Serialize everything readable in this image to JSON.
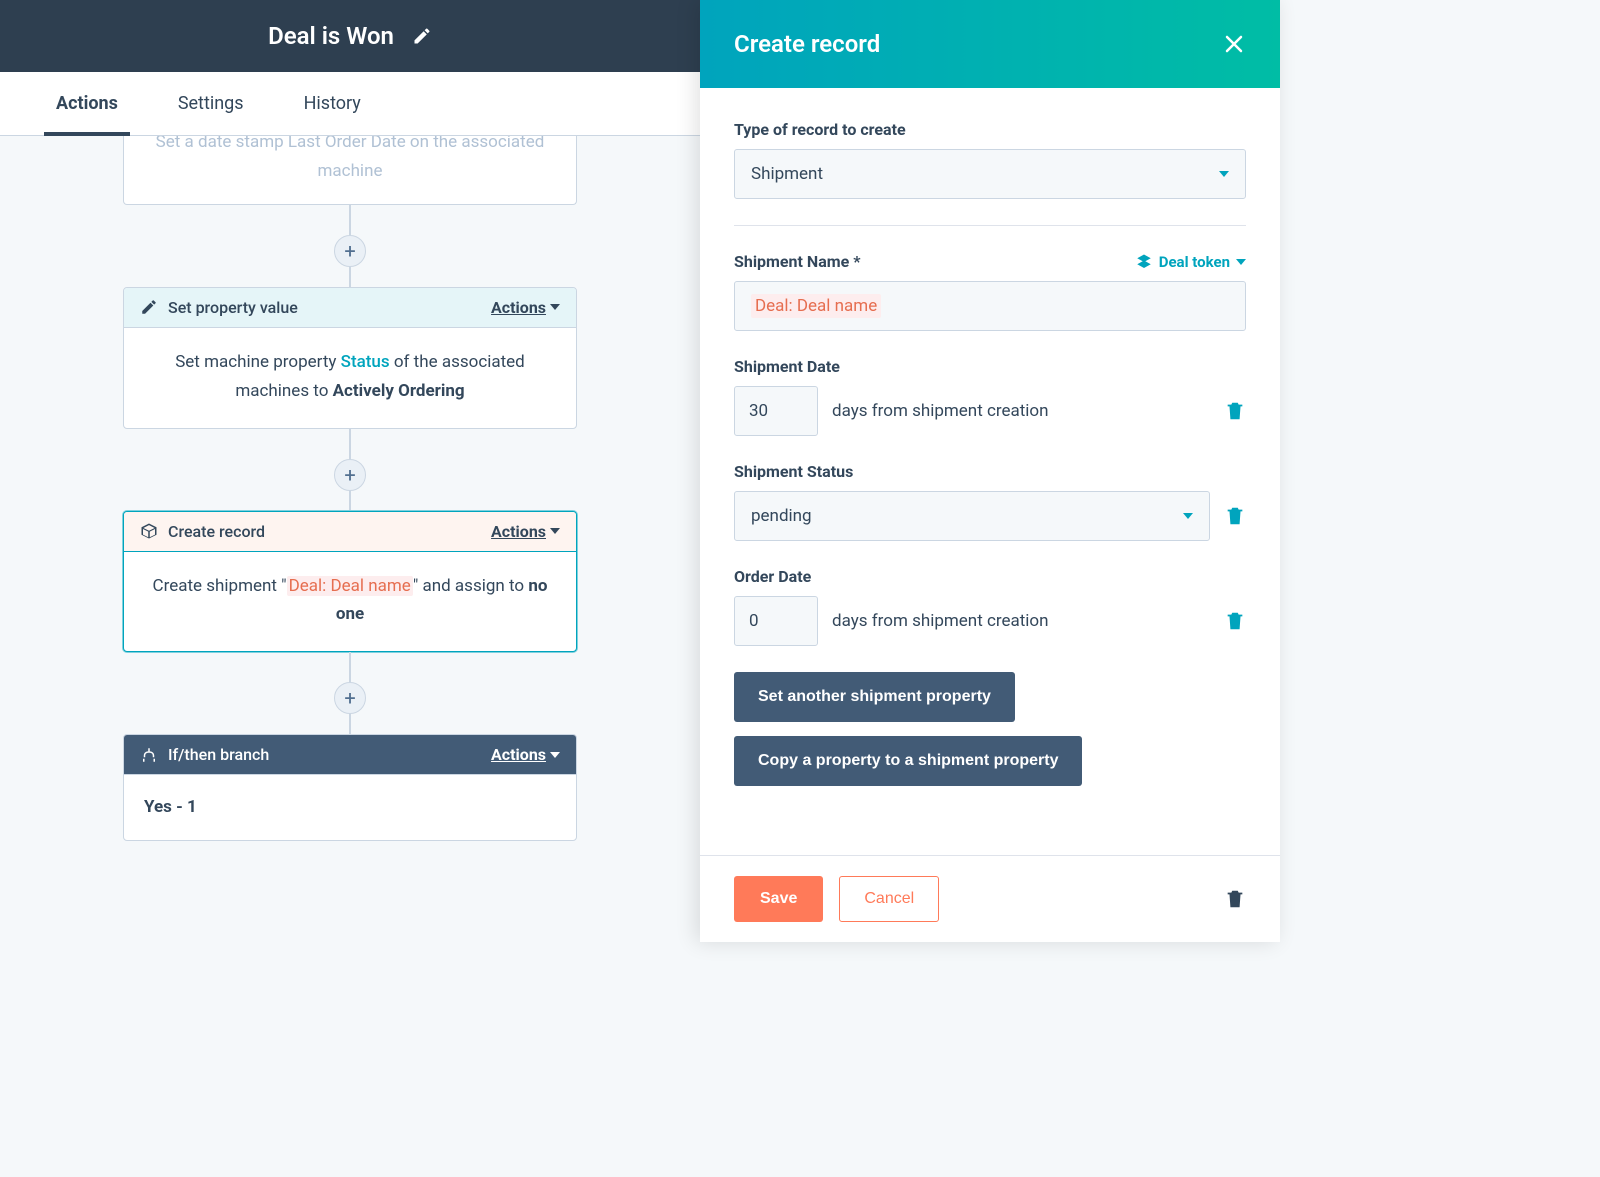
{
  "header": {
    "title": "Deal is Won"
  },
  "tabs": {
    "items": [
      "Actions",
      "Settings",
      "History"
    ],
    "active_index": 0
  },
  "workflow": {
    "actions_label": "Actions",
    "card0": {
      "body_prefix": "Set a date stamp ",
      "body_token": "Last Order Date",
      "body_suffix": " on the asso­ciated machine"
    },
    "card1": {
      "title": "Set property value",
      "body_prefix": "Set machine property ",
      "body_link": "Status",
      "body_mid": " of the associated machines to ",
      "body_bold": "Actively Ordering"
    },
    "card2": {
      "title": "Create record",
      "body_prefix": "Create shipment \"",
      "body_token": "Deal: Deal name",
      "body_mid": "\" and as­sign to ",
      "body_bold": "no one"
    },
    "card3": {
      "title": "If/then branch",
      "body": "Yes - 1"
    }
  },
  "panel": {
    "title": "Create record",
    "type_label": "Type of record to create",
    "type_value": "Shipment",
    "name_label": "Shipment Name *",
    "deal_token_link": "Deal token",
    "name_value_token": "Deal: Deal name",
    "date_label": "Shipment Date",
    "date_value": "30",
    "date_suffix": "days from shipment creation",
    "status_label": "Shipment Status",
    "status_value": "pending",
    "order_label": "Order Date",
    "order_value": "0",
    "order_suffix": "days from shipment creation",
    "set_another_btn": "Set another shipment property",
    "copy_prop_btn": "Copy a property to a shipment property",
    "save": "Save",
    "cancel": "Cancel"
  }
}
